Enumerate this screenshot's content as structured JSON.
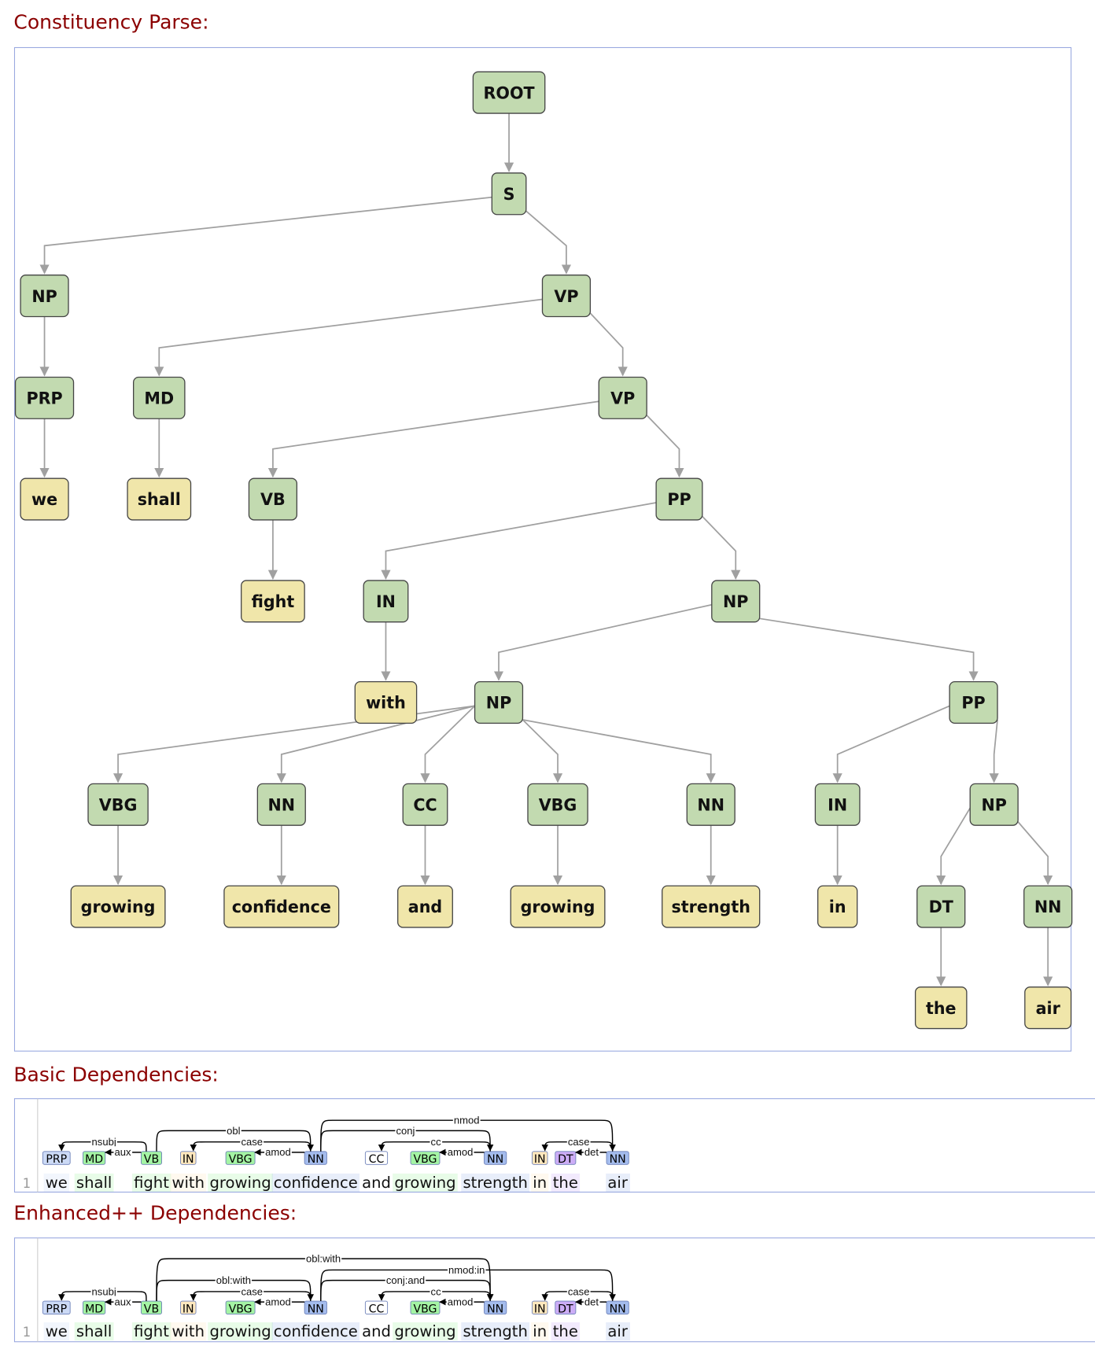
{
  "sections": {
    "constituency_title": "Constituency Parse:",
    "basic_title": "Basic Dependencies:",
    "enhanced_title": "Enhanced++ Dependencies:"
  },
  "colors": {
    "title": "#8b0000",
    "phrase_node": "#c2dab0",
    "word_node": "#f0e6aa",
    "panel_border": "#9aa9e0",
    "tag_colors": {
      "PRP": "#ccdaf6",
      "MD": "#a4f4a4",
      "VB": "#a4f4a4",
      "IN": "#ffe8be",
      "VBG": "#a4f4a4",
      "NN": "#a4bced",
      "CC": "#ffffff",
      "DT": "#ccadf6"
    }
  },
  "tree": {
    "label": "ROOT",
    "children": [
      {
        "label": "S",
        "children": [
          {
            "label": "NP",
            "children": [
              {
                "label": "PRP",
                "children": [
                  {
                    "label": "we",
                    "word": true
                  }
                ]
              }
            ]
          },
          {
            "label": "VP",
            "children": [
              {
                "label": "MD",
                "children": [
                  {
                    "label": "shall",
                    "word": true
                  }
                ]
              },
              {
                "label": "VP",
                "children": [
                  {
                    "label": "VB",
                    "children": [
                      {
                        "label": "fight",
                        "word": true
                      }
                    ]
                  },
                  {
                    "label": "PP",
                    "children": [
                      {
                        "label": "IN",
                        "children": [
                          {
                            "label": "with",
                            "word": true
                          }
                        ]
                      },
                      {
                        "label": "NP",
                        "children": [
                          {
                            "label": "NP",
                            "children": [
                              {
                                "label": "VBG",
                                "children": [
                                  {
                                    "label": "growing",
                                    "word": true
                                  }
                                ]
                              },
                              {
                                "label": "NN",
                                "children": [
                                  {
                                    "label": "confidence",
                                    "word": true
                                  }
                                ]
                              },
                              {
                                "label": "CC",
                                "children": [
                                  {
                                    "label": "and",
                                    "word": true
                                  }
                                ]
                              },
                              {
                                "label": "VBG",
                                "children": [
                                  {
                                    "label": "growing",
                                    "word": true
                                  }
                                ]
                              },
                              {
                                "label": "NN",
                                "children": [
                                  {
                                    "label": "strength",
                                    "word": true
                                  }
                                ]
                              }
                            ]
                          },
                          {
                            "label": "PP",
                            "children": [
                              {
                                "label": "IN",
                                "children": [
                                  {
                                    "label": "in",
                                    "word": true
                                  }
                                ]
                              },
                              {
                                "label": "NP",
                                "children": [
                                  {
                                    "label": "DT",
                                    "children": [
                                      {
                                        "label": "the",
                                        "word": true
                                      }
                                    ]
                                  },
                                  {
                                    "label": "NN",
                                    "children": [
                                      {
                                        "label": "air",
                                        "word": true
                                      }
                                    ]
                                  }
                                ]
                              }
                            ]
                          }
                        ]
                      }
                    ]
                  }
                ]
              }
            ]
          }
        ]
      }
    ]
  },
  "sentence_number": "1",
  "tokens": [
    {
      "word": "we",
      "tag": "PRP"
    },
    {
      "word": "shall",
      "tag": "MD"
    },
    {
      "word": "fight",
      "tag": "VB"
    },
    {
      "word": "with",
      "tag": "IN"
    },
    {
      "word": "growing",
      "tag": "VBG"
    },
    {
      "word": "confidence",
      "tag": "NN"
    },
    {
      "word": "and",
      "tag": "CC"
    },
    {
      "word": "growing",
      "tag": "VBG"
    },
    {
      "word": "strength",
      "tag": "NN"
    },
    {
      "word": "in",
      "tag": "IN"
    },
    {
      "word": "the",
      "tag": "DT"
    },
    {
      "word": "air",
      "tag": "NN"
    }
  ],
  "basic_dependencies": [
    {
      "head": 2,
      "dep": 0,
      "label": "nsubj"
    },
    {
      "head": 2,
      "dep": 1,
      "label": "aux"
    },
    {
      "head": 2,
      "dep": 5,
      "label": "obl"
    },
    {
      "head": 5,
      "dep": 3,
      "label": "case"
    },
    {
      "head": 5,
      "dep": 4,
      "label": "amod"
    },
    {
      "head": 5,
      "dep": 8,
      "label": "conj"
    },
    {
      "head": 8,
      "dep": 6,
      "label": "cc"
    },
    {
      "head": 8,
      "dep": 7,
      "label": "amod"
    },
    {
      "head": 5,
      "dep": 11,
      "label": "nmod"
    },
    {
      "head": 11,
      "dep": 9,
      "label": "case"
    },
    {
      "head": 11,
      "dep": 10,
      "label": "det"
    }
  ],
  "enhanced_dependencies": [
    {
      "head": 2,
      "dep": 0,
      "label": "nsubj"
    },
    {
      "head": 2,
      "dep": 1,
      "label": "aux"
    },
    {
      "head": 2,
      "dep": 8,
      "label": "obl:with"
    },
    {
      "head": 2,
      "dep": 5,
      "label": "obl:with"
    },
    {
      "head": 5,
      "dep": 3,
      "label": "case"
    },
    {
      "head": 5,
      "dep": 4,
      "label": "amod"
    },
    {
      "head": 5,
      "dep": 8,
      "label": "conj:and"
    },
    {
      "head": 8,
      "dep": 6,
      "label": "cc"
    },
    {
      "head": 8,
      "dep": 7,
      "label": "amod"
    },
    {
      "head": 5,
      "dep": 11,
      "label": "nmod:in"
    },
    {
      "head": 11,
      "dep": 9,
      "label": "case"
    },
    {
      "head": 11,
      "dep": 10,
      "label": "det"
    }
  ]
}
